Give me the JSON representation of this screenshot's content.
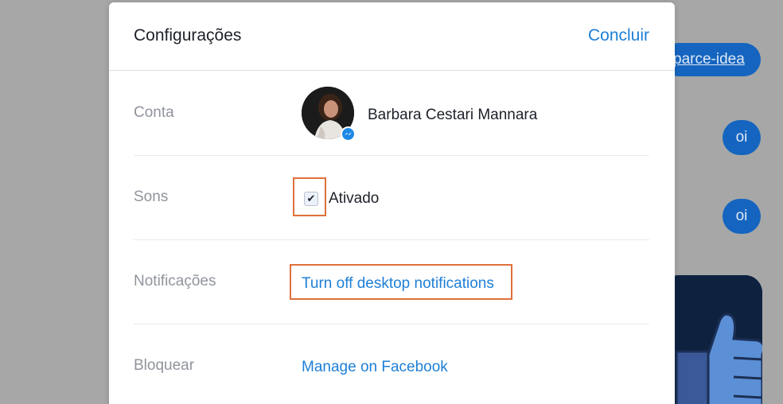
{
  "background_chat": {
    "link_message": "parce-idea",
    "messages": [
      "oi",
      "oi"
    ]
  },
  "modal": {
    "title": "Configurações",
    "done_label": "Concluir",
    "account": {
      "label": "Conta",
      "name": "Barbara Cestari Mannara"
    },
    "sounds": {
      "label": "Sons",
      "checked": true,
      "checkmark": "✔",
      "checkbox_label": "Ativado"
    },
    "notifications": {
      "label": "Notificações",
      "link": "Turn off desktop notifications"
    },
    "block": {
      "label": "Bloquear",
      "link": "Manage on Facebook"
    }
  },
  "colors": {
    "link_blue": "#1e7fd6",
    "highlight_orange": "#e0703a",
    "bubble_blue": "#1565c0",
    "overlay_gray": "#a7a7a7"
  },
  "icons": [
    "check-icon",
    "messenger-icon",
    "thumbs-up-icon"
  ]
}
